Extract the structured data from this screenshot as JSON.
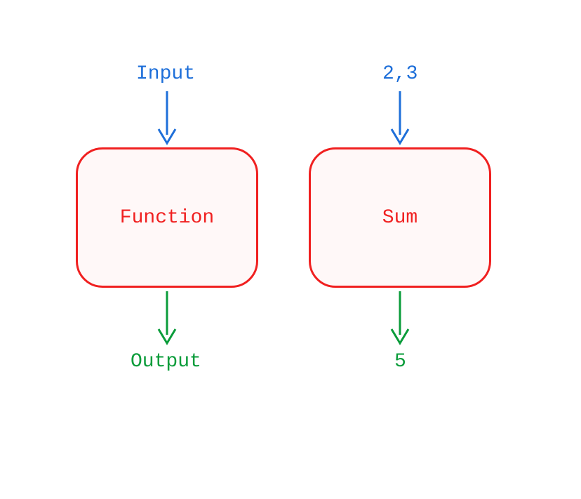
{
  "diagram": {
    "left": {
      "input": "Input",
      "box": "Function",
      "output": "Output"
    },
    "right": {
      "input": "2,3",
      "box": "Sum",
      "output": "5"
    }
  },
  "colors": {
    "input": "#1e6fd9",
    "box_border": "#f02020",
    "box_fill": "#fff8f8",
    "box_text": "#f02020",
    "output": "#0a9c3a"
  }
}
